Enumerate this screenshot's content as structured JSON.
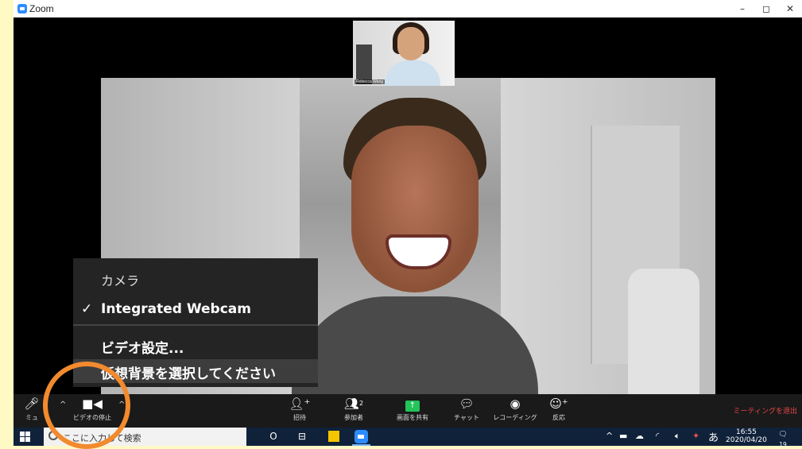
{
  "window": {
    "title": "Zoom",
    "controls": [
      "–",
      "◻",
      "✕"
    ]
  },
  "thumbnail": {
    "name": "Rebecca Wang"
  },
  "camera_menu": {
    "header": "カメラ",
    "selected_camera": "Integrated Webcam",
    "check_mark": "✓",
    "video_settings": "ビデオ設定...",
    "virtual_background": "仮想背景を選択してください"
  },
  "toolbar": {
    "mute_label": "ミュ",
    "video_label": "ビデオの停止",
    "invite_label": "招待",
    "participants_label": "参加者",
    "participants_count": "2",
    "share_label": "画面を共有",
    "chat_label": "チャット",
    "record_label": "レコーディング",
    "reactions_label": "反応",
    "end_label": "ミーティングを退出",
    "caret": "^"
  },
  "taskbar": {
    "search_placeholder": "ここに入力して検索",
    "cortana_icon": "O",
    "taskview_icon": "⊟",
    "ime": "あ",
    "time": "16:55",
    "date": "2020/04/20",
    "notification_count": "19"
  },
  "colors": {
    "highlight_ring": "#F28A2E",
    "zoom_blue": "#2D8CFF",
    "share_green": "#23C45A",
    "end_red": "#E84545"
  }
}
